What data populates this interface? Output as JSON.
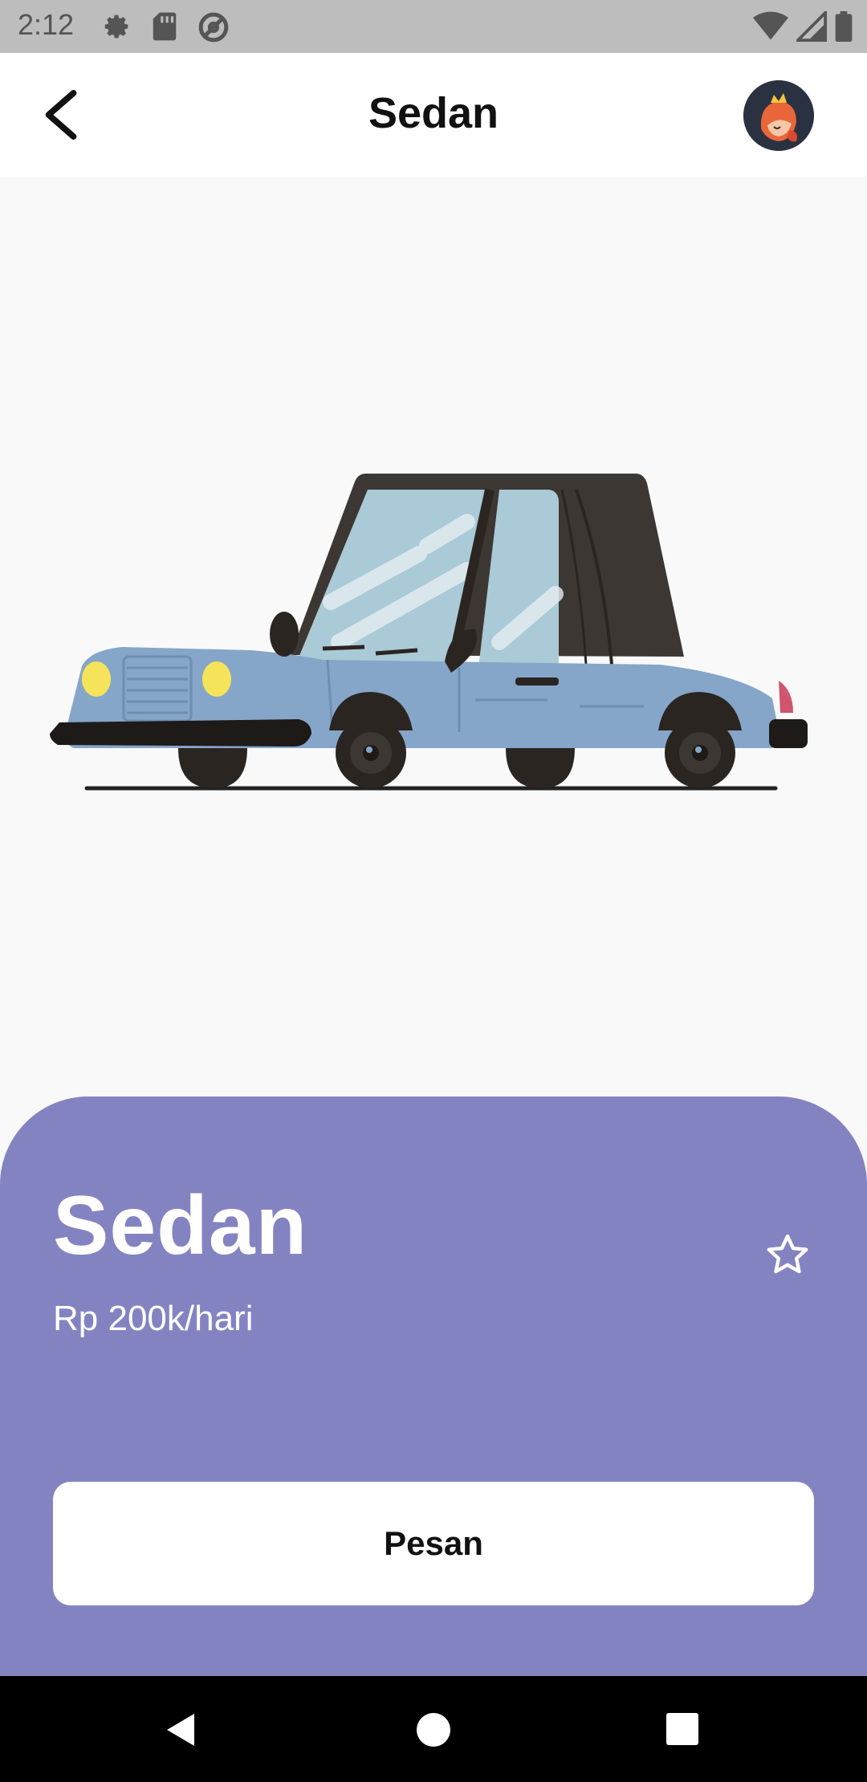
{
  "status_bar": {
    "time": "2:12",
    "icons_left": [
      "settings-icon",
      "sd-card-icon",
      "no-disturb-icon"
    ],
    "icons_right": [
      "wifi-icon",
      "signal-icon",
      "battery-icon"
    ]
  },
  "app_bar": {
    "title": "Sedan",
    "back_icon": "arrow-left-icon",
    "avatar_icon": "avatar-icon"
  },
  "car": {
    "name": "Sedan",
    "price": "Rp 200k/hari",
    "favorite_icon": "star-outline-icon",
    "order_label": "Pesan"
  },
  "colors": {
    "panel": "#8483c2",
    "background": "#f9f9f9",
    "car_body": "#85a6c8",
    "car_roof": "#3d3733"
  },
  "nav_bar": {
    "icons": [
      "nav-back-icon",
      "nav-home-icon",
      "nav-recent-icon"
    ]
  }
}
